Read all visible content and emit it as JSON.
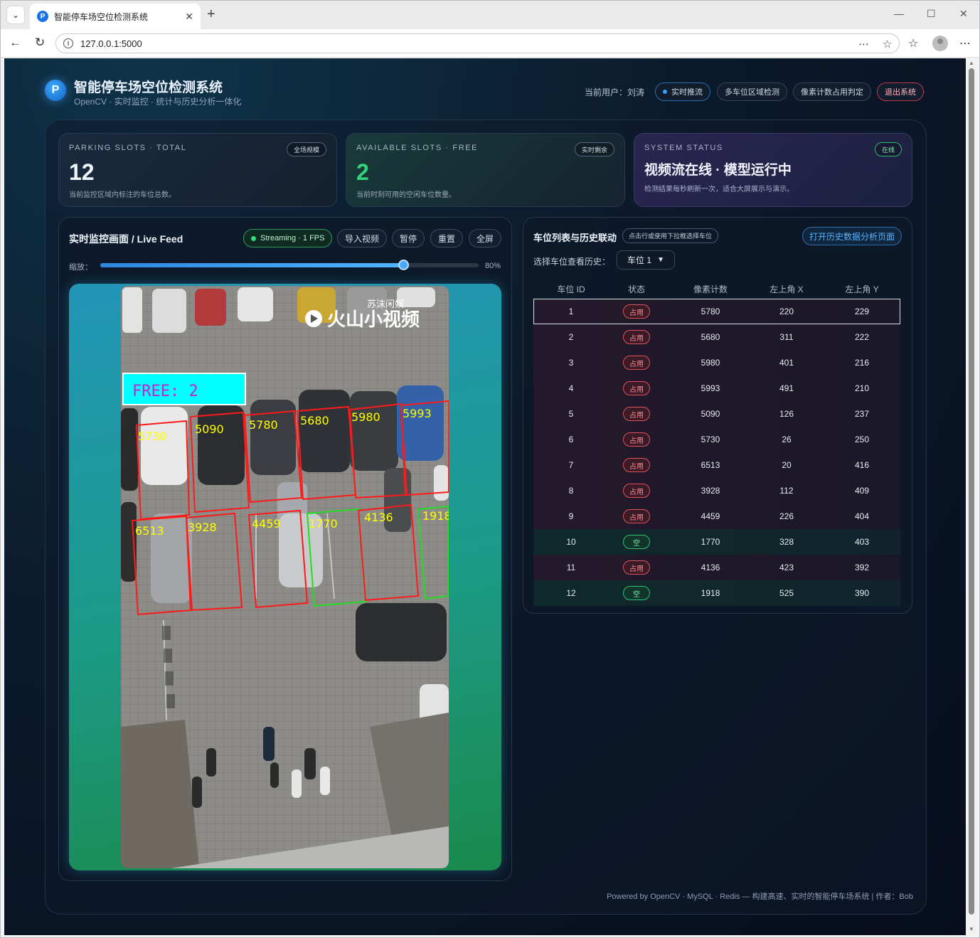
{
  "browser": {
    "tab_title": "智能停车场空位检测系统",
    "url": "127.0.0.1:5000",
    "favicon_letter": "P"
  },
  "header": {
    "logo_letter": "P",
    "title": "智能停车场空位检测系统",
    "subtitle": "OpenCV · 实时监控 · 统计与历史分析一体化",
    "user": "当前用户：刘涛",
    "pills": [
      "实时推流",
      "多车位区域检测",
      "像素计数占用判定"
    ],
    "logout": "退出系统"
  },
  "cards": {
    "total": {
      "label": "PARKING SLOTS · TOTAL",
      "tag": "全场规模",
      "value": "12",
      "desc": "当前监控区域内标注的车位总数。"
    },
    "free": {
      "label": "AVAILABLE SLOTS · FREE",
      "tag": "实时剩余",
      "value": "2",
      "desc": "当前时刻可用的空闲车位数量。"
    },
    "status": {
      "label": "SYSTEM STATUS",
      "tag": "在线",
      "title": "视频流在线 · 模型运行中",
      "desc": "检测结果每秒刷新一次，适合大屏展示与演示。"
    }
  },
  "live": {
    "title": "实时监控画面 / Live Feed",
    "stream": "Streaming · 1 FPS",
    "buttons": [
      "导入视频",
      "暂停",
      "重置",
      "全屏"
    ],
    "zoom_label": "缩放：",
    "zoom_value": "80%",
    "zoom_fraction": 0.8,
    "overlay": {
      "free_text": "FREE: 2",
      "watermark_small": "苏沫闲娱",
      "watermark_big": "火山小视频",
      "slot_counts": [
        "5730",
        "5090",
        "5780",
        "5680",
        "5980",
        "5993",
        "6513",
        "3928",
        "4459",
        "1770",
        "4136",
        "1918"
      ]
    }
  },
  "table_panel": {
    "title": "车位列表与历史联动",
    "tag": "点击行或使用下拉框选择车位",
    "history_button": "打开历史数据分析页面",
    "select_label": "选择车位查看历史：",
    "select_value": "车位 1",
    "headers": [
      "车位 ID",
      "状态",
      "像素计数",
      "左上角 X",
      "左上角 Y"
    ],
    "rows": [
      {
        "id": "1",
        "status": "占用",
        "count": "5780",
        "x": "220",
        "y": "229"
      },
      {
        "id": "2",
        "status": "占用",
        "count": "5680",
        "x": "311",
        "y": "222"
      },
      {
        "id": "3",
        "status": "占用",
        "count": "5980",
        "x": "401",
        "y": "216"
      },
      {
        "id": "4",
        "status": "占用",
        "count": "5993",
        "x": "491",
        "y": "210"
      },
      {
        "id": "5",
        "status": "占用",
        "count": "5090",
        "x": "126",
        "y": "237"
      },
      {
        "id": "6",
        "status": "占用",
        "count": "5730",
        "x": "26",
        "y": "250"
      },
      {
        "id": "7",
        "status": "占用",
        "count": "6513",
        "x": "20",
        "y": "416"
      },
      {
        "id": "8",
        "status": "占用",
        "count": "3928",
        "x": "112",
        "y": "409"
      },
      {
        "id": "9",
        "status": "占用",
        "count": "4459",
        "x": "226",
        "y": "404"
      },
      {
        "id": "10",
        "status": "空",
        "count": "1770",
        "x": "328",
        "y": "403"
      },
      {
        "id": "11",
        "status": "占用",
        "count": "4136",
        "x": "423",
        "y": "392"
      },
      {
        "id": "12",
        "status": "空",
        "count": "1918",
        "x": "525",
        "y": "390"
      }
    ]
  },
  "footer": "Powered by OpenCV · MySQL · Redis — 构建高速、实时的智能停车场系统 | 作者：Bob",
  "colors": {
    "accent": "#4aa8ff",
    "free": "#34d27a",
    "occupied": "#e0505f",
    "logout": "#c0394b"
  }
}
